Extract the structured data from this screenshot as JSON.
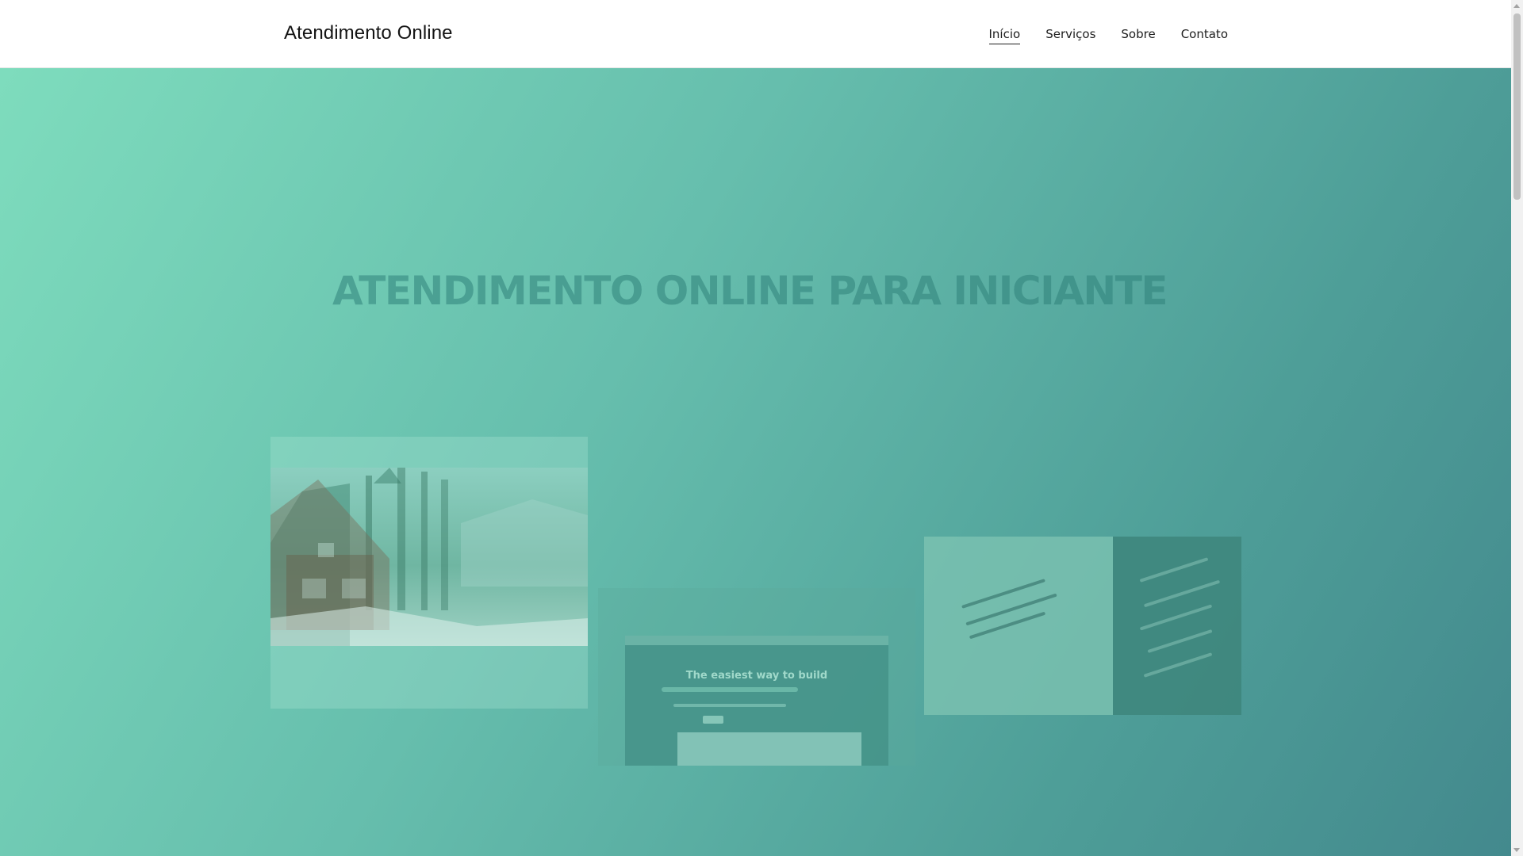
{
  "header": {
    "brand": "Atendimento Online",
    "nav": [
      {
        "label": "Início"
      },
      {
        "label": "Serviços"
      },
      {
        "label": "Sobre"
      },
      {
        "label": "Contato"
      }
    ]
  },
  "hero": {
    "title": "ATENDIMENTO ONLINE PARA INICIANTE"
  },
  "showcase": {
    "mockup_headline": "The easiest way to build"
  },
  "colors": {
    "hero_gradient_start": "#7edcbd",
    "hero_gradient_end": "#43898d",
    "header_background": "#ffffff",
    "text_dark": "#141414"
  },
  "icons": [
    "scroll-up-arrow-icon",
    "scroll-down-arrow-icon"
  ]
}
